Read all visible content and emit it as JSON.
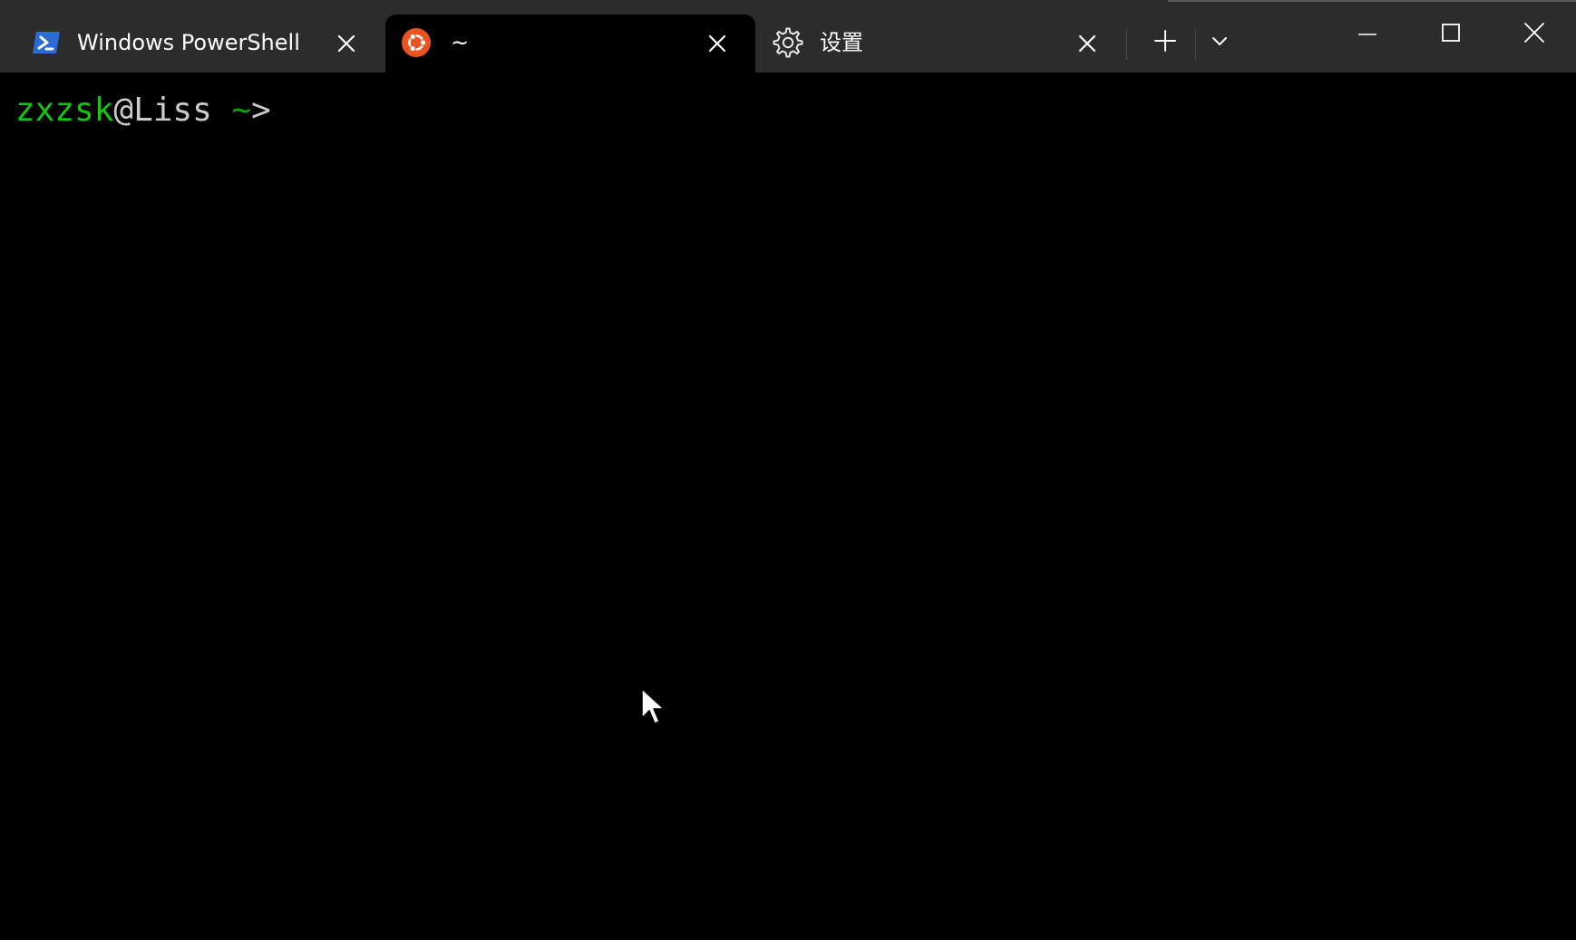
{
  "tabs": [
    {
      "title": "Windows PowerShell",
      "icon": "powershell-icon",
      "active": false
    },
    {
      "title": "~",
      "icon": "ubuntu-icon",
      "active": true
    },
    {
      "title": "设置",
      "icon": "gear-icon",
      "active": false
    }
  ],
  "toolbar": {
    "new_tab_icon": "plus-icon",
    "dropdown_icon": "chevron-down-icon"
  },
  "window_controls": [
    "minimize-icon",
    "maximize-icon",
    "close-icon"
  ],
  "terminal": {
    "prompt_user": "zxzsk",
    "prompt_at": "@",
    "prompt_host": "Liss",
    "prompt_space": " ",
    "prompt_tilde": "~",
    "prompt_symbol": ">"
  },
  "colors": {
    "titlebar_bg": "#2c2c2c",
    "terminal_bg": "#000000",
    "prompt_user": "#16c60c",
    "prompt_tilde": "#13a10e",
    "ubuntu_orange": "#e95420",
    "powershell_blue": "#2b6bd8"
  }
}
